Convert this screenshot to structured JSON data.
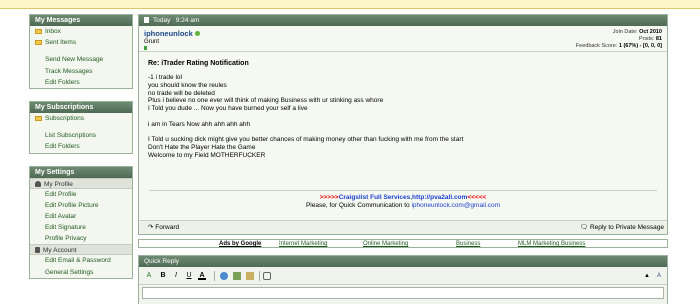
{
  "sidebar": {
    "messages": {
      "title": "My Messages",
      "items": [
        "Inbox",
        "Sent Items",
        "Send New Message",
        "Track Messages",
        "Edit Folders"
      ]
    },
    "subscriptions": {
      "title": "My Subscriptions",
      "items": [
        "Subscriptions",
        "List Subscriptions",
        "Edit Folders"
      ]
    },
    "settings": {
      "title": "My Settings",
      "profile_header": "My Profile",
      "profile_items": [
        "Edit Profile",
        "Edit Profile Picture",
        "Edit Avatar",
        "Edit Signature",
        "Profile Privacy"
      ],
      "account_header": "My Account",
      "account_items": [
        "Edit Email & Password",
        "General Settings"
      ]
    }
  },
  "post": {
    "date": "Today",
    "time": "9:24 am",
    "username": "iphoneunlock",
    "user_title": "Grunt",
    "join_date_label": "Join Date:",
    "join_date": "Oct 2010",
    "posts_label": "Posts:",
    "posts": "81",
    "feedback_label": "Feedback Score:",
    "feedback": "1 (67%) - [0, 0, 0]",
    "title": "Re: iTrader Rating Notification",
    "message": "-1 i trade lol\nyou should know the reules\nno trade will be deleted\nPlus i believe no one ever will think of making Business with ur stinking ass whore\nI Told you dude ... Now you have burned your self a live\n\ni am in Tears Now ahh ahh ahh ahh\n\nI Told u sucking dick might give you better chances of making money other than fucking with me from the start\nDon't Hate the Player Hate the Game\nWelcome to my Field MOTHERFUCKER",
    "sig_arrows_left": ">>>>>",
    "sig_service": "Craigslist Full Services",
    "sig_comma": ",",
    "sig_link": "http://pva2all.com",
    "sig_arrows_right": "<<<<<",
    "sig_line2_prefix": "Please, for Quick Communication to",
    "sig_email": "iphoneunlock.com@gmail.com",
    "forward_label": "Forward",
    "reply_label": "Reply to Private Message"
  },
  "ads": {
    "label": "Ads by Google",
    "links": [
      "Internet Marketing",
      "Online Marketing",
      "Business",
      "MLM Marketing Business"
    ]
  },
  "quick_reply": {
    "title": "Quick Reply",
    "toolbar": {
      "font_a": "A",
      "bold": "B",
      "italic": "I",
      "underline": "U",
      "color": "A"
    }
  }
}
